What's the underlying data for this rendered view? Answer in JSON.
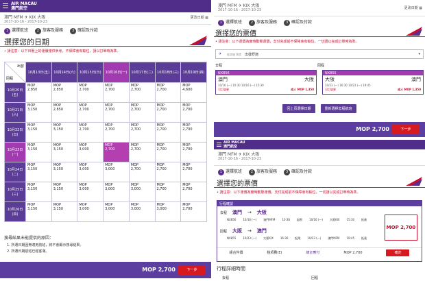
{
  "brand": {
    "line1": "AIR MACAU",
    "line2": "澳門航空"
  },
  "route": {
    "from": "澳門 MFM",
    "to": "KIX 大阪",
    "dates": "2017-10-16 - 2017-10-23"
  },
  "change_label": "更改日期",
  "steps": [
    {
      "num": "1",
      "label": "選擇航班"
    },
    {
      "num": "2",
      "label": "旅客及服務"
    },
    {
      "num": "3",
      "label": "確認及付款"
    }
  ],
  "left": {
    "title": "選擇您的日期",
    "notice": "• 請注意：以下日曆上的運價僅供參考，不保障會有輸位，請以訂單時為準。",
    "corner_top": "出發",
    "corner_bottom": "回程",
    "col_headers": [
      "10月13日(五)",
      "10月14日(六)",
      "10月15日(日)",
      "10月16日(一)",
      "10月17日(二)",
      "10月18日(三)",
      "10月19日(四)"
    ],
    "rows": [
      {
        "label": "10月20日(五)",
        "cells": [
          {
            "c": "MOP",
            "v": "2,850"
          },
          {
            "c": "MOP",
            "v": "2,850"
          },
          {
            "c": "MOP",
            "v": "2,700"
          },
          {
            "c": "MOP",
            "v": "2,700"
          },
          {
            "c": "MOP",
            "v": "2,700"
          },
          {
            "c": "MOP",
            "v": "2,700"
          },
          {
            "c": "MOP",
            "v": "4,600"
          }
        ]
      },
      {
        "label": "10月21日(六)",
        "cells": [
          {
            "c": "MOP",
            "v": "3,150"
          },
          {
            "c": "MOP",
            "v": "2,850"
          },
          {
            "c": "MOP",
            "v": "2,700"
          },
          {
            "c": "MOP",
            "v": "2,700"
          },
          {
            "c": "MOP",
            "v": "2,700"
          },
          {
            "c": "MOP",
            "v": "2,700"
          },
          {
            "c": "MOP",
            "v": "2,700"
          }
        ]
      },
      {
        "label": "10月22日(日)",
        "cells": [
          {
            "c": "MOP",
            "v": "3,150"
          },
          {
            "c": "MOP",
            "v": "3,150"
          },
          {
            "c": "MOP",
            "v": "2,700"
          },
          {
            "c": "MOP",
            "v": "2,700"
          },
          {
            "c": "MOP",
            "v": "2,700"
          },
          {
            "c": "MOP",
            "v": "2,700"
          },
          {
            "c": "MOP",
            "v": "2,700"
          }
        ]
      },
      {
        "label": "10月23日(一)",
        "cells": [
          {
            "c": "MOP",
            "v": "3,150"
          },
          {
            "c": "MOP",
            "v": "3,150"
          },
          {
            "c": "MOP",
            "v": "3,000"
          },
          {
            "c": "MOP",
            "v": "2,700"
          },
          {
            "c": "MOP",
            "v": "2,700"
          },
          {
            "c": "MOP",
            "v": "2,700"
          },
          {
            "c": "MOP",
            "v": "2,700"
          }
        ]
      },
      {
        "label": "10月24日(二)",
        "cells": [
          {
            "c": "MOP",
            "v": "3,150"
          },
          {
            "c": "MOP",
            "v": "3,150"
          },
          {
            "c": "MOP",
            "v": "3,000"
          },
          {
            "c": "MOP",
            "v": "3,000"
          },
          {
            "c": "MOP",
            "v": "2,700"
          },
          {
            "c": "MOP",
            "v": "2,700"
          },
          {
            "c": "MOP",
            "v": "2,700"
          }
        ]
      },
      {
        "label": "10月25日(三)",
        "cells": [
          {
            "c": "MOP",
            "v": "3,150"
          },
          {
            "c": "MOP",
            "v": "3,150"
          },
          {
            "c": "MOP",
            "v": "3,000"
          },
          {
            "c": "MOP",
            "v": "3,000"
          },
          {
            "c": "MOP",
            "v": "3,000"
          },
          {
            "c": "MOP",
            "v": "2,700"
          },
          {
            "c": "MOP",
            "v": "2,700"
          }
        ]
      },
      {
        "label": "10月26日(四)",
        "cells": [
          {
            "c": "MOP",
            "v": "3,150"
          },
          {
            "c": "MOP",
            "v": "3,150"
          },
          {
            "c": "MOP",
            "v": "3,000"
          },
          {
            "c": "MOP",
            "v": "3,000"
          },
          {
            "c": "MOP",
            "v": "3,000"
          },
          {
            "c": "MOP",
            "v": "3,000"
          },
          {
            "c": "MOP",
            "v": "2,700"
          }
        ]
      }
    ],
    "explain_title": "搜尋結果未能提供的原因：",
    "explain": [
      "1. 所選日期因無適用航班，將不會顯示搜尋結果。",
      "2. 所選日期航班已經客滿。"
    ],
    "price": "MOP 2,700",
    "next": "下一步"
  },
  "tr": {
    "title": "選擇您的票價",
    "notice": "• 請注意：以下運價為實時動態運價，支付完成前不保障會有輸位，一切請以完成訂單時為準。",
    "fare_small": "經濟艙 票價",
    "fare_value": "出發舒適",
    "outbound_label": "去程",
    "return_label": "回程",
    "out": {
      "code": "NX856",
      "from": "澳門",
      "to": "大阪",
      "time": "10/16 (一) 10:30 10/16 (一) 15:30",
      "change": "可訂變更",
      "price": "成人 MOP 1,350"
    },
    "ret": {
      "code": "NX855",
      "from": "大阪",
      "to": "澳門",
      "time": "10/23 (一) 16:30 10/23 (一) 19:45",
      "change": "可訂變更",
      "price": "成人 MOP 1,350"
    },
    "btn_back": "回上頁選擇日期",
    "btn_search": "重新選擇去程航班",
    "price": "MOP 2,700",
    "next": "下一步"
  },
  "br": {
    "title": "選擇您的票價",
    "notice": "• 請注意：以下運價為實時動態運價，支付完成前不保障會有輸位，一切請以完成訂單時為準。",
    "box_title": "行程確認",
    "out": {
      "label": "去程",
      "from": "澳門",
      "to": "大阪",
      "code": "NX856",
      "date": "10/16 (一)",
      "from_code": "澳門MFM",
      "dep": "10:30",
      "dep_lbl": "起飛",
      "arr_date": "10/16 (一)",
      "to_code": "大阪KIX",
      "arr": "15:30",
      "arr_lbl": "抵達"
    },
    "ret": {
      "label": "回程",
      "from": "大阪",
      "to": "澳門",
      "code": "NX855",
      "date": "10/23 (一)",
      "from_code": "大阪KIX",
      "dep": "16:30",
      "dep_lbl": "起飛",
      "arr_date": "10/23 (一)",
      "to_code": "澳門MFM",
      "arr": "19:45",
      "arr_lbl": "抵達"
    },
    "total": "MOP 2,700",
    "footer": [
      "組合件價",
      "稅項費(E)",
      "總計應付",
      "MOP 2,700"
    ],
    "confirm": "確定",
    "detail_title": "行程詳細時間",
    "detail_out": "去程",
    "detail_ret": "回程",
    "arrow": "→"
  }
}
